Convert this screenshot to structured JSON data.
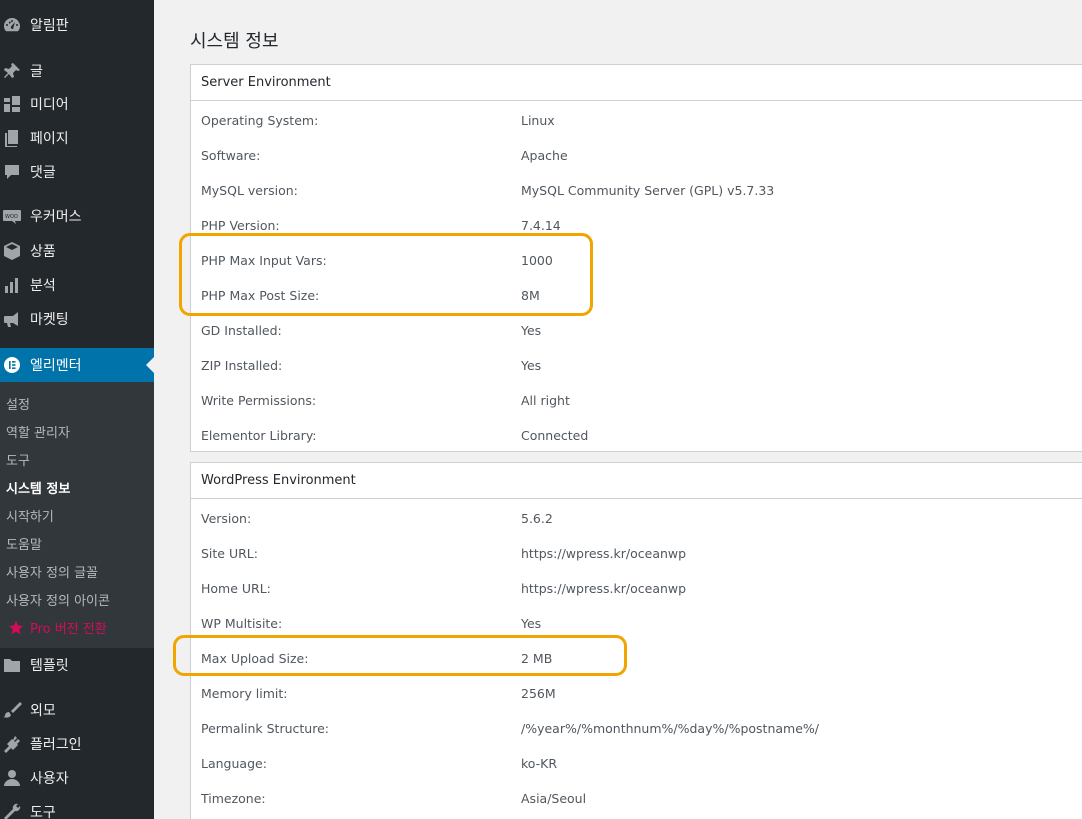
{
  "sidebar": {
    "items": [
      {
        "label": "알림판",
        "icon": "dashboard-icon"
      },
      {
        "label": "글",
        "icon": "pin-icon"
      },
      {
        "label": "미디어",
        "icon": "media-icon"
      },
      {
        "label": "페이지",
        "icon": "page-icon"
      },
      {
        "label": "댓글",
        "icon": "comment-icon"
      },
      {
        "label": "우커머스",
        "icon": "woocommerce-icon"
      },
      {
        "label": "상품",
        "icon": "product-box-icon"
      },
      {
        "label": "분석",
        "icon": "bar-chart-icon"
      },
      {
        "label": "마켓팅",
        "icon": "megaphone-icon"
      },
      {
        "label": "엘리멘터",
        "icon": "elementor-icon"
      },
      {
        "label": "템플릿",
        "icon": "folder-icon"
      },
      {
        "label": "외모",
        "icon": "paintbrush-icon"
      },
      {
        "label": "플러그인",
        "icon": "plugin-icon"
      },
      {
        "label": "사용자",
        "icon": "user-icon"
      },
      {
        "label": "도구",
        "icon": "wrench-icon"
      }
    ],
    "submenu": [
      {
        "label": "설정"
      },
      {
        "label": "역할 관리자"
      },
      {
        "label": "도구"
      },
      {
        "label": "시스템 정보"
      },
      {
        "label": "시작하기"
      },
      {
        "label": "도움말"
      },
      {
        "label": "사용자 정의 글꼴"
      },
      {
        "label": "사용자 정의 아이콘"
      },
      {
        "label": "Pro 버전 전환"
      }
    ]
  },
  "page": {
    "title": "시스템 정보"
  },
  "server_env": {
    "title": "Server Environment",
    "rows": [
      {
        "label": "Operating System:",
        "value": "Linux"
      },
      {
        "label": "Software:",
        "value": "Apache"
      },
      {
        "label": "MySQL version:",
        "value": "MySQL Community Server (GPL) v5.7.33"
      },
      {
        "label": "PHP Version:",
        "value": "7.4.14"
      },
      {
        "label": "PHP Max Input Vars:",
        "value": "1000"
      },
      {
        "label": "PHP Max Post Size:",
        "value": "8M"
      },
      {
        "label": "GD Installed:",
        "value": "Yes"
      },
      {
        "label": "ZIP Installed:",
        "value": "Yes"
      },
      {
        "label": "Write Permissions:",
        "value": "All right"
      },
      {
        "label": "Elementor Library:",
        "value": "Connected"
      }
    ]
  },
  "wp_env": {
    "title": "WordPress Environment",
    "rows": [
      {
        "label": "Version:",
        "value": "5.6.2"
      },
      {
        "label": "Site URL:",
        "value": "https://wpress.kr/oceanwp"
      },
      {
        "label": "Home URL:",
        "value": "https://wpress.kr/oceanwp"
      },
      {
        "label": "WP Multisite:",
        "value": "Yes"
      },
      {
        "label": "Max Upload Size:",
        "value": "2 MB"
      },
      {
        "label": "Memory limit:",
        "value": "256M"
      },
      {
        "label": "Permalink Structure:",
        "value": "/%year%/%monthnum%/%day%/%postname%/"
      },
      {
        "label": "Language:",
        "value": "ko-KR"
      },
      {
        "label": "Timezone:",
        "value": "Asia/Seoul"
      }
    ]
  },
  "colors": {
    "sidebar_bg": "#23282d",
    "active_bg": "#0073aa",
    "pro_color": "#d30c5c",
    "highlight": "#f0a500"
  }
}
